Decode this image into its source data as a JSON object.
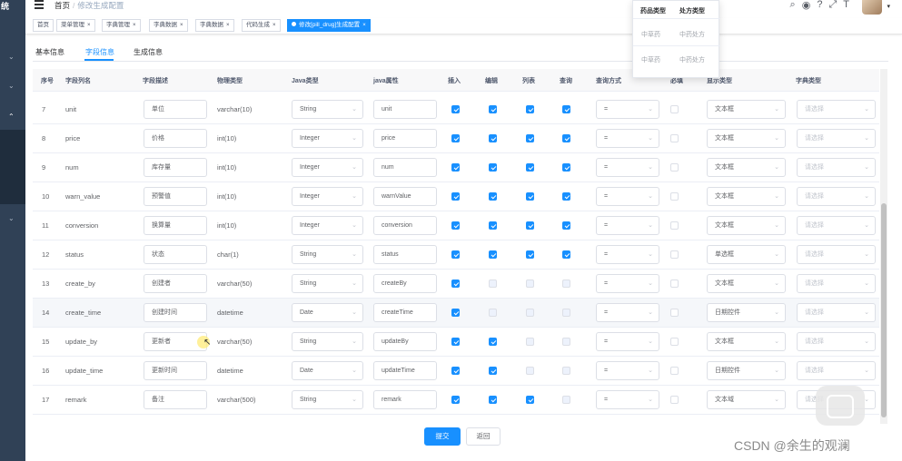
{
  "sidebar": {
    "logo": "统",
    "chevrons": [
      "⌄",
      "⌄",
      "⌃",
      "⌄"
    ]
  },
  "navbar": {
    "breadcrumb": [
      "首页",
      "修改生成配置"
    ],
    "separator": "/",
    "icons": [
      "search-icon",
      "github-icon",
      "question-icon",
      "fullscreen-icon",
      "font-size-icon"
    ],
    "icon_glyphs": [
      "⌕",
      "◉",
      "?",
      "⤢",
      "T"
    ]
  },
  "tags": [
    {
      "label": "首页",
      "closable": false,
      "active": false
    },
    {
      "label": "菜单管理",
      "closable": true,
      "active": false
    },
    {
      "label": "字典管理",
      "closable": true,
      "active": false
    },
    {
      "label": "字典数据",
      "closable": true,
      "active": false
    },
    {
      "label": "字典数据",
      "closable": true,
      "active": false
    },
    {
      "label": "代码生成",
      "closable": true,
      "active": false
    },
    {
      "label": "修改[pill_drug]生成配置",
      "closable": true,
      "active": true
    }
  ],
  "tabs": [
    "基本信息",
    "字段信息",
    "生成信息"
  ],
  "active_tab": "字段信息",
  "columns": [
    "序号",
    "字段列名",
    "字段描述",
    "物理类型",
    "Java类型",
    "java属性",
    "插入",
    "编辑",
    "列表",
    "查询",
    "查询方式",
    "必填",
    "显示类型",
    "字典类型"
  ],
  "placeholder": "请选择",
  "rows": [
    {
      "no": "7",
      "column": "unit",
      "desc": "单位",
      "db_type": "varchar(10)",
      "java_type": "String",
      "java_field": "unit",
      "insert": true,
      "edit": true,
      "list": true,
      "query": true,
      "query_type": "=",
      "required": false,
      "html_type": "文本框",
      "dict_type": ""
    },
    {
      "no": "8",
      "column": "price",
      "desc": "价格",
      "db_type": "int(10)",
      "java_type": "Integer",
      "java_field": "price",
      "insert": true,
      "edit": true,
      "list": true,
      "query": true,
      "query_type": "=",
      "required": false,
      "html_type": "文本框",
      "dict_type": ""
    },
    {
      "no": "9",
      "column": "num",
      "desc": "库存量",
      "db_type": "int(10)",
      "java_type": "Integer",
      "java_field": "num",
      "insert": true,
      "edit": true,
      "list": true,
      "query": true,
      "query_type": "=",
      "required": false,
      "html_type": "文本框",
      "dict_type": ""
    },
    {
      "no": "10",
      "column": "warn_value",
      "desc": "预警值",
      "db_type": "int(10)",
      "java_type": "Integer",
      "java_field": "warnValue",
      "insert": true,
      "edit": true,
      "list": true,
      "query": true,
      "query_type": "=",
      "required": false,
      "html_type": "文本框",
      "dict_type": ""
    },
    {
      "no": "11",
      "column": "conversion",
      "desc": "换算量",
      "db_type": "int(10)",
      "java_type": "Integer",
      "java_field": "conversion",
      "insert": true,
      "edit": true,
      "list": true,
      "query": true,
      "query_type": "=",
      "required": false,
      "html_type": "文本框",
      "dict_type": ""
    },
    {
      "no": "12",
      "column": "status",
      "desc": "状态",
      "db_type": "char(1)",
      "java_type": "String",
      "java_field": "status",
      "insert": true,
      "edit": true,
      "list": true,
      "query": true,
      "query_type": "=",
      "required": false,
      "html_type": "单选框",
      "dict_type": ""
    },
    {
      "no": "13",
      "column": "create_by",
      "desc": "创建者",
      "db_type": "varchar(50)",
      "java_type": "String",
      "java_field": "createBy",
      "insert": true,
      "edit": false,
      "list": false,
      "query": false,
      "query_type": "=",
      "required": false,
      "html_type": "文本框",
      "dict_type": ""
    },
    {
      "no": "14",
      "column": "create_time",
      "desc": "创建时间",
      "db_type": "datetime",
      "java_type": "Date",
      "java_field": "createTime",
      "insert": true,
      "edit": false,
      "list": false,
      "query": false,
      "query_type": "=",
      "required": false,
      "html_type": "日期控件",
      "dict_type": ""
    },
    {
      "no": "15",
      "column": "update_by",
      "desc": "更新者",
      "db_type": "varchar(50)",
      "java_type": "String",
      "java_field": "updateBy",
      "insert": true,
      "edit": true,
      "list": false,
      "query": false,
      "query_type": "=",
      "required": false,
      "html_type": "文本框",
      "dict_type": ""
    },
    {
      "no": "16",
      "column": "update_time",
      "desc": "更新时间",
      "db_type": "datetime",
      "java_type": "Date",
      "java_field": "updateTime",
      "insert": true,
      "edit": true,
      "list": false,
      "query": false,
      "query_type": "=",
      "required": false,
      "html_type": "日期控件",
      "dict_type": ""
    },
    {
      "no": "17",
      "column": "remark",
      "desc": "备注",
      "db_type": "varchar(500)",
      "java_type": "String",
      "java_field": "remark",
      "insert": true,
      "edit": true,
      "list": true,
      "query": false,
      "query_type": "=",
      "required": false,
      "html_type": "文本域",
      "dict_type": ""
    }
  ],
  "buttons": {
    "submit": "提交",
    "back": "返回"
  },
  "dropdown": {
    "headers": [
      "药品类型",
      "处方类型"
    ],
    "rows": [
      [
        "中草药",
        "中药处方"
      ],
      [
        "中草药",
        "中药处方"
      ]
    ]
  },
  "watermark": "CSDN @余生的观澜",
  "colors": {
    "primary": "#1890ff",
    "sidebar": "#304156",
    "header_bg": "#f8f8f9"
  }
}
